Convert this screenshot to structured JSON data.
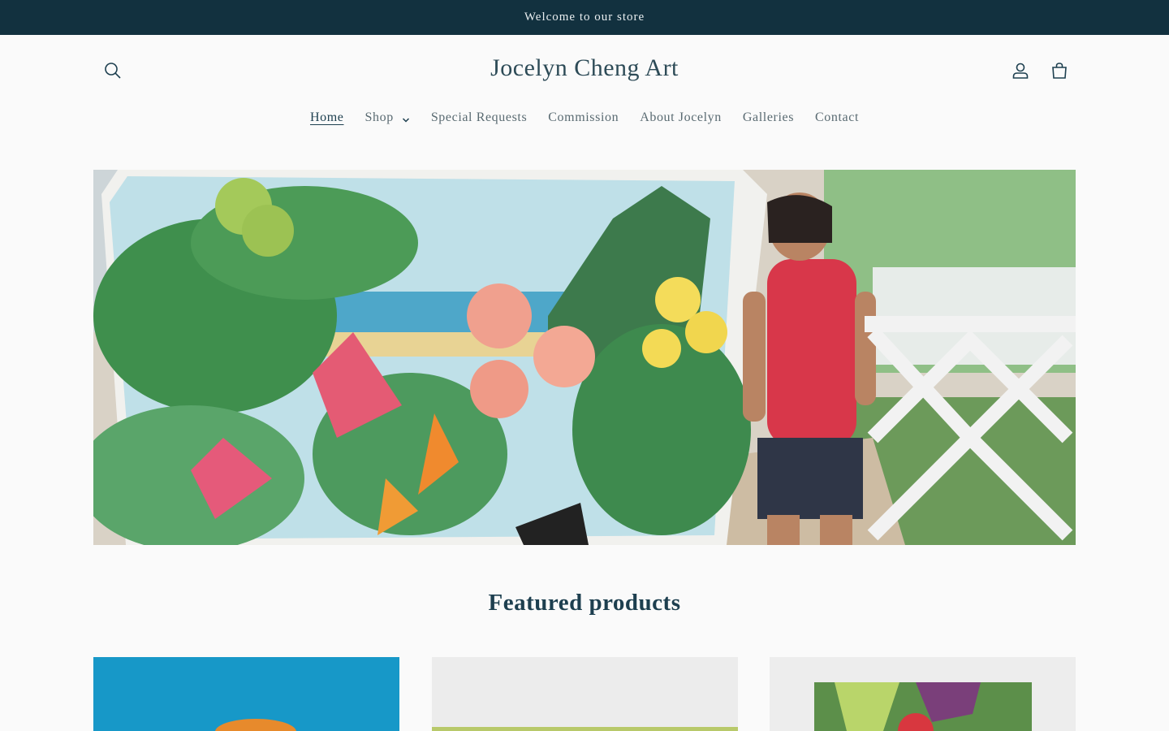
{
  "announcement": {
    "text": "Welcome to our store"
  },
  "header": {
    "logo": "Jocelyn Cheng Art",
    "icons": {
      "search": "search-icon",
      "account": "account-icon",
      "cart": "cart-icon"
    }
  },
  "nav": {
    "items": [
      {
        "label": "Home",
        "active": true
      },
      {
        "label": "Shop",
        "has_dropdown": true
      },
      {
        "label": "Special Requests"
      },
      {
        "label": "Commission"
      },
      {
        "label": "About Jocelyn"
      },
      {
        "label": "Galleries"
      },
      {
        "label": "Contact"
      }
    ]
  },
  "featured": {
    "title": "Featured products"
  },
  "colors": {
    "announcement_bg": "#12313f",
    "text": "#1d3f4f",
    "background": "#fafafa"
  }
}
